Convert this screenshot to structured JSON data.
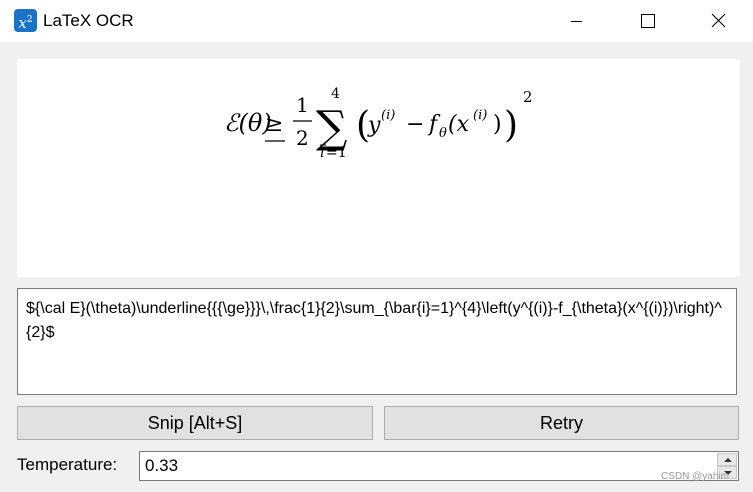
{
  "window": {
    "title": "LaTeX OCR",
    "icon_label": "x",
    "icon_sup": "2",
    "controls": [
      "minimize-icon",
      "maximize-icon",
      "close-icon"
    ]
  },
  "preview": {
    "latex": "\\mathcal{E}(\\theta)\\underline{\\ge}\\frac{1}{2}\\sum_{\\bar{i}=1}^{4}\\left(y^{(i)}-f_\\theta(x^{(i)})\\right)^2",
    "parts": {
      "lhs": "ℰ(θ)",
      "ge": "≥",
      "frac_num": "1",
      "frac_den": "2",
      "sum": "∑",
      "sum_upper": "4",
      "sum_lower_var": "i",
      "sum_lower_rest": "=1",
      "open_paren": "(",
      "y": "y",
      "y_sup": "(i)",
      "minus": "−",
      "f": "f",
      "f_sub": "θ",
      "x_open": "(x",
      "x_sup": "(i)",
      "x_close": ")",
      "close_paren": ")",
      "power": "2"
    }
  },
  "latex_output": {
    "text": "${\\cal E}(\\theta)\\underline{{{\\ge}}}\\,\\frac{1}{2}\\sum_{\\bar{i}=1}^{4}\\left(y^{(i)}-f_{\\theta}(x^{(i)})\\right)^{2}$"
  },
  "buttons": {
    "snip": "Snip [Alt+S]",
    "retry": "Retry"
  },
  "temperature": {
    "label": "Temperature:",
    "value": "0.33"
  },
  "watermark": "CSDN @yahim",
  "colors": {
    "app_icon": "#1a73c9",
    "button_bg": "#e1e1e1",
    "window_bg": "#f0f0f0"
  }
}
